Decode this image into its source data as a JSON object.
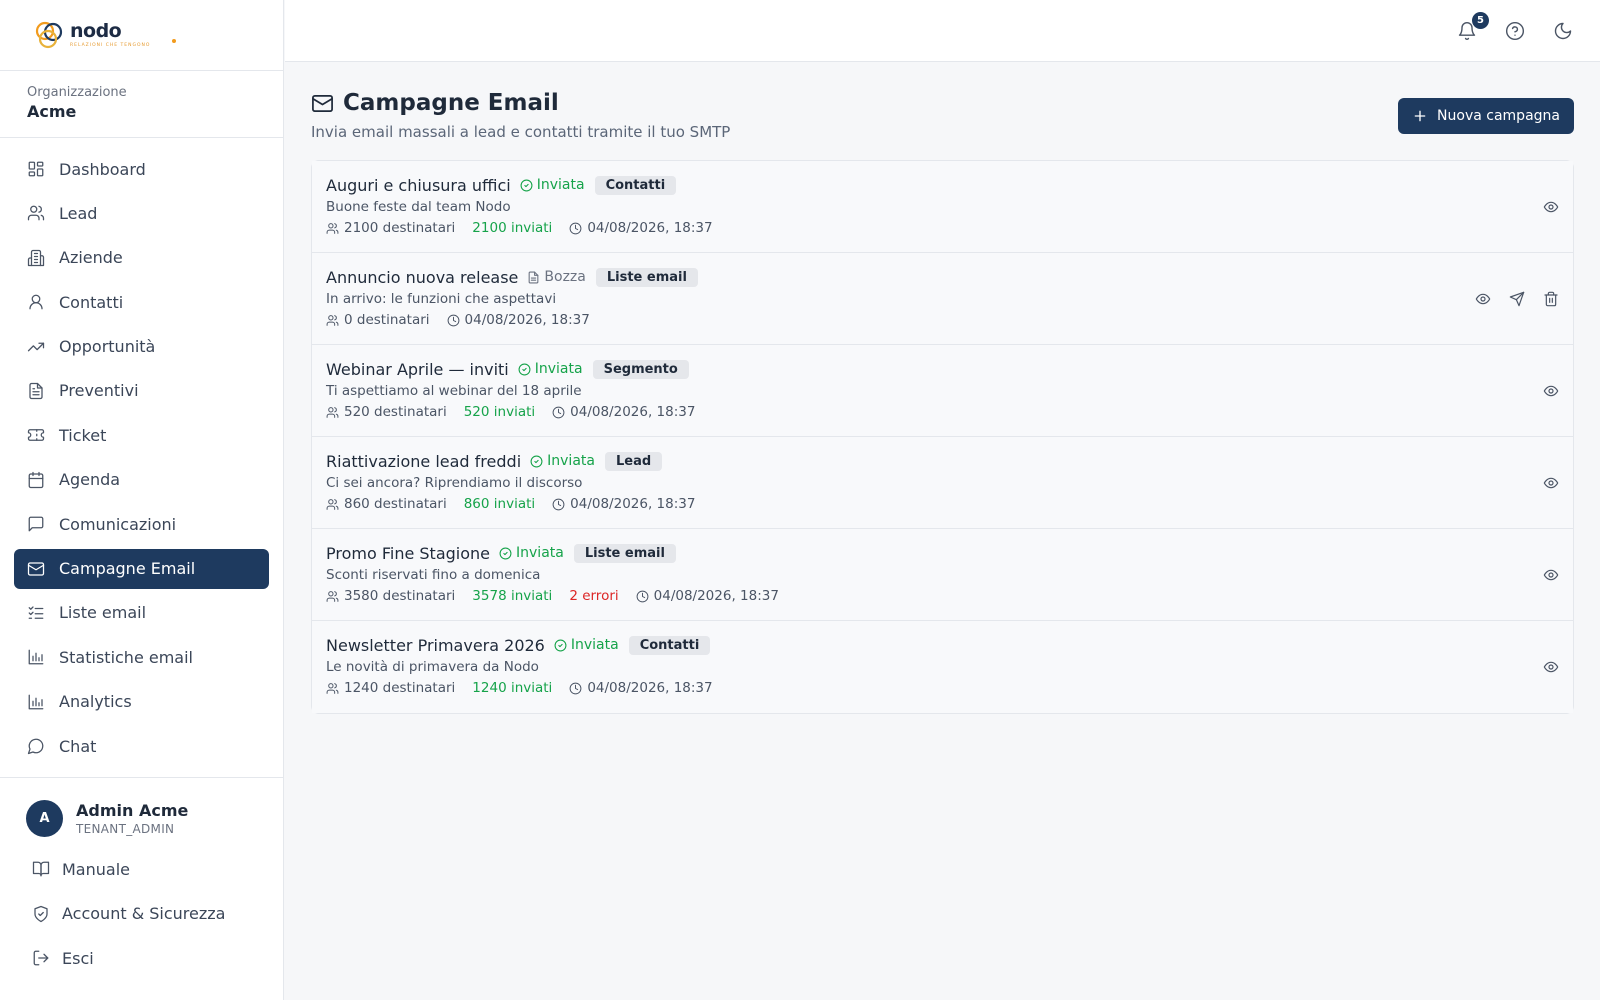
{
  "brand": {
    "name": "nodo",
    "tagline": "RELAZIONI CHE TENGONO"
  },
  "organization": {
    "label": "Organizzazione",
    "name": "Acme"
  },
  "nav": [
    {
      "label": "Dashboard",
      "icon": "dashboard-icon"
    },
    {
      "label": "Lead",
      "icon": "users-icon"
    },
    {
      "label": "Aziende",
      "icon": "building-icon"
    },
    {
      "label": "Contatti",
      "icon": "user-icon"
    },
    {
      "label": "Opportunità",
      "icon": "trending-icon"
    },
    {
      "label": "Preventivi",
      "icon": "document-icon"
    },
    {
      "label": "Ticket",
      "icon": "ticket-icon"
    },
    {
      "label": "Agenda",
      "icon": "calendar-icon"
    },
    {
      "label": "Comunicazioni",
      "icon": "message-square-icon"
    },
    {
      "label": "Campagne Email",
      "icon": "mail-icon",
      "active": true
    },
    {
      "label": "Liste email",
      "icon": "list-check-icon"
    },
    {
      "label": "Statistiche email",
      "icon": "bar-chart-icon"
    },
    {
      "label": "Analytics",
      "icon": "bar-chart-icon"
    },
    {
      "label": "Chat",
      "icon": "chat-bubble-icon"
    }
  ],
  "user": {
    "initial": "A",
    "name": "Admin Acme",
    "role": "TENANT_ADMIN"
  },
  "footer": [
    {
      "label": "Manuale",
      "icon": "book-icon"
    },
    {
      "label": "Account & Sicurezza",
      "icon": "shield-icon"
    },
    {
      "label": "Esci",
      "icon": "logout-icon"
    }
  ],
  "topbar": {
    "notifications_count": "5"
  },
  "page": {
    "title": "Campagne Email",
    "subtitle": "Invia email massali a lead e contatti tramite il tuo SMTP",
    "new_button": "Nuova campagna"
  },
  "campaigns": [
    {
      "name": "Auguri e chiusura uffici",
      "status": "Inviata",
      "status_type": "sent",
      "tag": "Contatti",
      "subject": "Buone feste dal team Nodo",
      "recipients": "2100 destinatari",
      "sent": "2100 inviati",
      "errors": "",
      "date": "04/08/2026, 18:37",
      "draft": false
    },
    {
      "name": "Annuncio nuova release",
      "status": "Bozza",
      "status_type": "draft",
      "tag": "Liste email",
      "subject": "In arrivo: le funzioni che aspettavi",
      "recipients": "0 destinatari",
      "sent": "",
      "errors": "",
      "date": "04/08/2026, 18:37",
      "draft": true
    },
    {
      "name": "Webinar Aprile — inviti",
      "status": "Inviata",
      "status_type": "sent",
      "tag": "Segmento",
      "subject": "Ti aspettiamo al webinar del 18 aprile",
      "recipients": "520 destinatari",
      "sent": "520 inviati",
      "errors": "",
      "date": "04/08/2026, 18:37",
      "draft": false
    },
    {
      "name": "Riattivazione lead freddi",
      "status": "Inviata",
      "status_type": "sent",
      "tag": "Lead",
      "subject": "Ci sei ancora? Riprendiamo il discorso",
      "recipients": "860 destinatari",
      "sent": "860 inviati",
      "errors": "",
      "date": "04/08/2026, 18:37",
      "draft": false
    },
    {
      "name": "Promo Fine Stagione",
      "status": "Inviata",
      "status_type": "sent",
      "tag": "Liste email",
      "subject": "Sconti riservati fino a domenica",
      "recipients": "3580 destinatari",
      "sent": "3578 inviati",
      "errors": "2 errori",
      "date": "04/08/2026, 18:37",
      "draft": false
    },
    {
      "name": "Newsletter Primavera 2026",
      "status": "Inviata",
      "status_type": "sent",
      "tag": "Contatti",
      "subject": "Le novità di primavera da Nodo",
      "recipients": "1240 destinatari",
      "sent": "1240 inviati",
      "errors": "",
      "date": "04/08/2026, 18:37",
      "draft": false
    }
  ],
  "colors": {
    "primary": "#1e3a5f",
    "success": "#16a34a",
    "error": "#dc2626",
    "brand_orange": "#f29b1d"
  }
}
